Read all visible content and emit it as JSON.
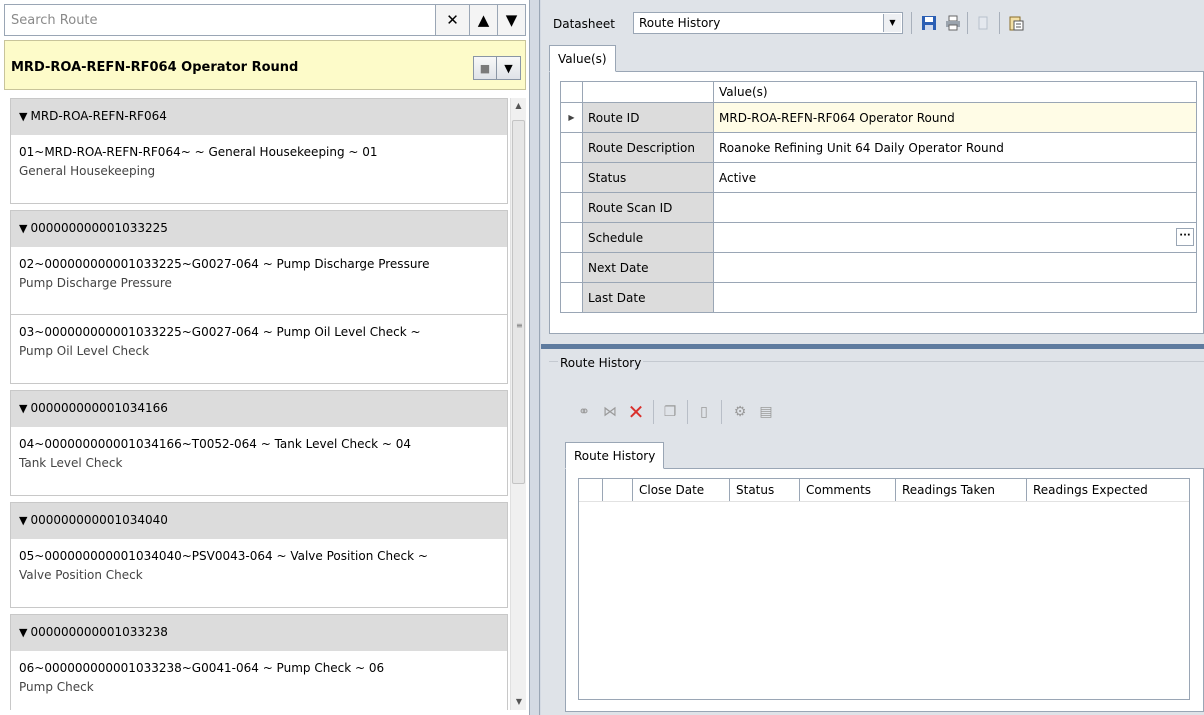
{
  "search": {
    "placeholder": "Search Route",
    "clear_icon": "close-icon",
    "up_icon": "arrow-up-icon",
    "down_icon": "arrow-down-icon"
  },
  "route_header": {
    "title": "MRD-ROA-REFN-RF064 Operator Round"
  },
  "groups": [
    {
      "header": "MRD-ROA-REFN-RF064",
      "line1": "01~MRD-ROA-REFN-RF064~ ~ General Housekeeping ~ 01",
      "line2": "General Housekeeping"
    },
    {
      "header": "000000000001033225",
      "line1": "02~000000000001033225~G0027-064 ~ Pump Discharge Pressure",
      "line2": "Pump Discharge Pressure"
    },
    {
      "header": "",
      "line1": "03~000000000001033225~G0027-064 ~ Pump Oil Level Check ~",
      "line2": "Pump Oil Level Check"
    },
    {
      "header": "000000000001034166",
      "line1": "04~000000000001034166~T0052-064 ~ Tank Level Check ~ 04",
      "line2": "Tank Level Check"
    },
    {
      "header": "000000000001034040",
      "line1": "05~000000000001034040~PSV0043-064 ~ Valve Position Check ~",
      "line2": "Valve Position Check"
    },
    {
      "header": "000000000001033238",
      "line1": "06~000000000001033238~G0041-064 ~ Pump Check ~ 06",
      "line2": "Pump Check"
    }
  ],
  "datasheet": {
    "label": "Datasheet",
    "selected": "Route History"
  },
  "top_tab": "Value(s)",
  "grid": {
    "column": "Value(s)",
    "rows": [
      {
        "name": "Route ID",
        "value": "MRD-ROA-REFN-RF064 Operator Round"
      },
      {
        "name": "Route Description",
        "value": "Roanoke Refining Unit 64 Daily Operator Round"
      },
      {
        "name": "Status",
        "value": "Active"
      },
      {
        "name": "Route Scan ID",
        "value": ""
      },
      {
        "name": "Schedule",
        "value": ""
      },
      {
        "name": "Next Date",
        "value": ""
      },
      {
        "name": "Last Date",
        "value": ""
      }
    ]
  },
  "route_history": {
    "legend": "Route History",
    "tab": "Route History",
    "columns": [
      "Close Date",
      "Status",
      "Comments",
      "Readings Taken",
      "Readings Expected"
    ]
  },
  "colors": {
    "header_yellow": "#fdfbc9",
    "splitter_blue": "#5e7b9f",
    "group_gray": "#dcdcdc",
    "delete_red": "#d9302c"
  }
}
